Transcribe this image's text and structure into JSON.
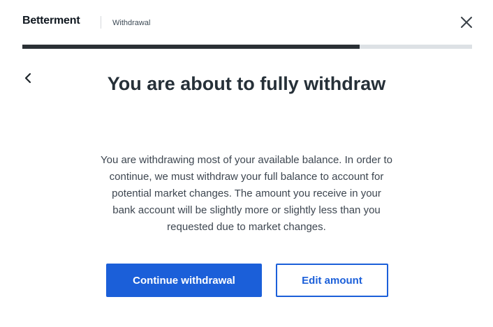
{
  "header": {
    "logo_text": "Betterment",
    "section_label": "Withdrawal",
    "close_icon": "close-icon"
  },
  "progress": {
    "fraction": 0.75,
    "fill_color": "#2a3035",
    "track_color": "#dde1e5"
  },
  "nav": {
    "back_icon": "chevron-left-icon"
  },
  "main": {
    "title": "You are about to fully withdraw",
    "body": "You are withdrawing most of your available balance. In order to continue, we must withdraw your full balance to account for potential market changes. The amount you receive in your bank account will be slightly more or slightly less than you requested due to market changes."
  },
  "actions": {
    "primary_label": "Continue withdrawal",
    "secondary_label": "Edit amount"
  },
  "colors": {
    "accent": "#1b5fd9",
    "text_dark": "#263038"
  }
}
